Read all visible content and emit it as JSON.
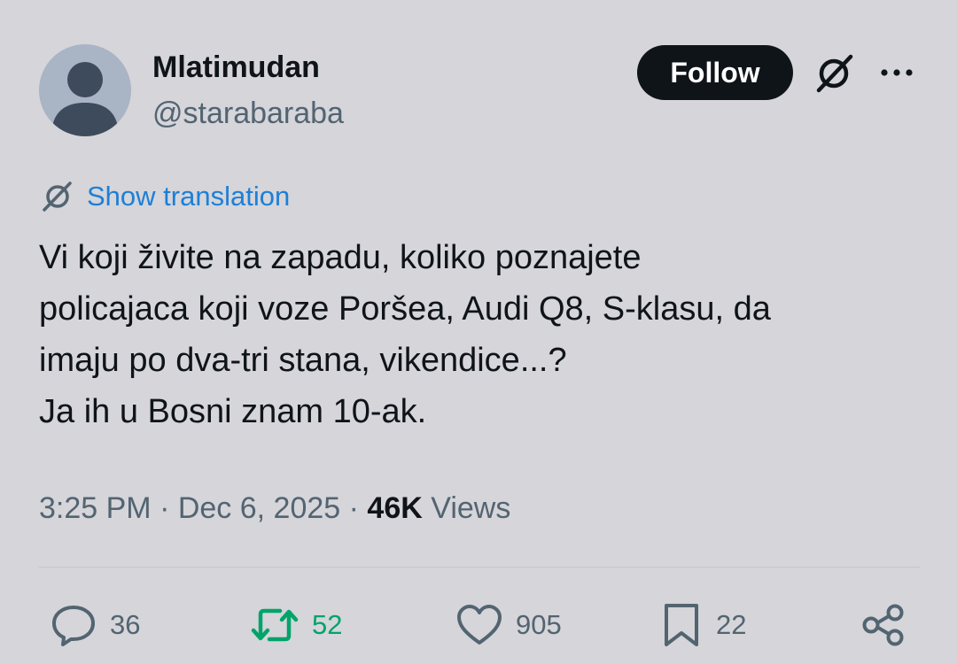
{
  "user": {
    "display_name": "Mlatimudan",
    "handle": "@starabaraba",
    "avatar_icon": "default-avatar-icon"
  },
  "header": {
    "follow_label": "Follow",
    "grok_icon": "grok-icon",
    "more_icon": "more-options-icon"
  },
  "translation": {
    "icon": "grok-icon",
    "label": "Show translation"
  },
  "tweet": {
    "lines": [
      "Vi koji živite na zapadu, koliko poznajete",
      "policajaca koji voze Poršea, Audi Q8, S-klasu, da",
      "imaju po dva-tri stana, vikendice...?",
      "Ja ih u Bosni znam 10-ak."
    ]
  },
  "meta": {
    "time": "3:25 PM",
    "separator": " · ",
    "date": "Dec 6, 2025",
    "views_count": "46K",
    "views_label": "Views"
  },
  "actions": {
    "replies": "36",
    "retweets": "52",
    "likes": "905",
    "bookmarks": "22"
  },
  "colors": {
    "background": "#d5d5da",
    "text_primary": "#0f1419",
    "text_secondary": "#536471",
    "link": "#1d7fd6",
    "retweet_green": "#00a469",
    "follow_button": "#0f1419"
  }
}
